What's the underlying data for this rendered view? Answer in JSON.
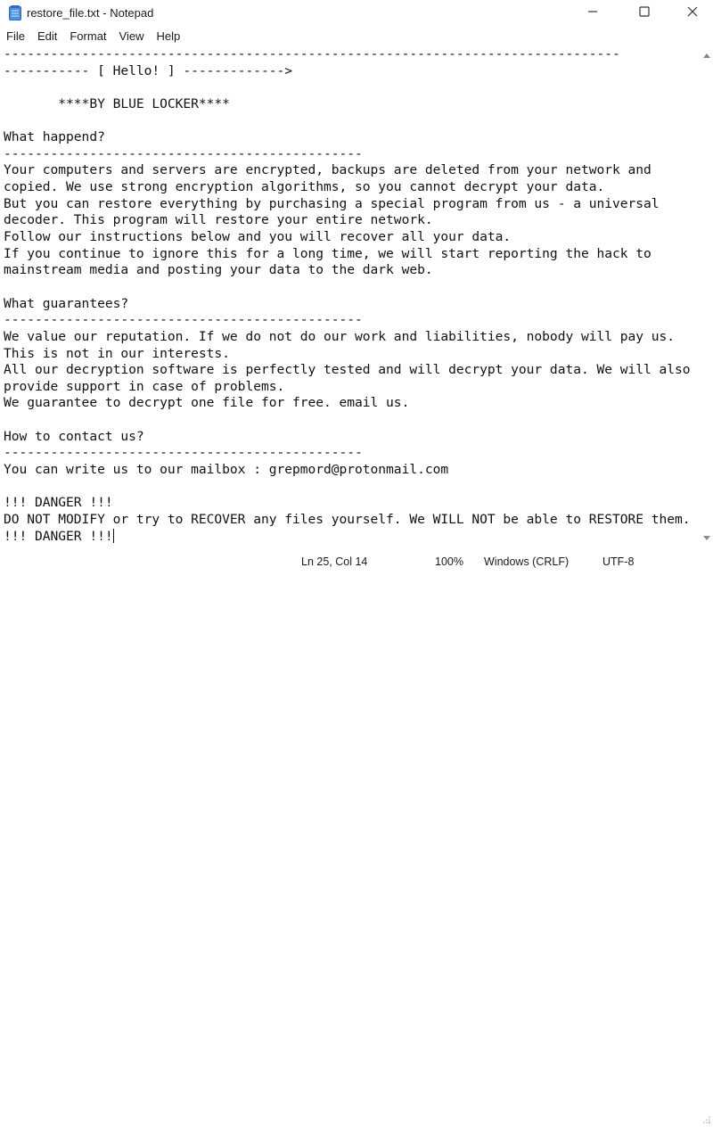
{
  "window": {
    "title": "restore_file.txt - Notepad",
    "app_icon": "notepad-icon",
    "controls": {
      "minimize": "minimize-icon",
      "maximize": "maximize-icon",
      "close": "close-icon"
    }
  },
  "menu": {
    "items": [
      {
        "label": "File"
      },
      {
        "label": "Edit"
      },
      {
        "label": "Format"
      },
      {
        "label": "View"
      },
      {
        "label": "Help"
      }
    ]
  },
  "editor": {
    "lines": [
      "-------------------------------------------------------------------------------",
      "----------- [ Hello! ] ------------->",
      "",
      "       ****BY BLUE LOCKER****",
      "",
      "What happend?",
      "----------------------------------------------",
      "Your computers and servers are encrypted, backups are deleted from your network and",
      "copied. We use strong encryption algorithms, so you cannot decrypt your data.",
      "But you can restore everything by purchasing a special program from us - a universal",
      "decoder. This program will restore your entire network.",
      "Follow our instructions below and you will recover all your data.",
      "If you continue to ignore this for a long time, we will start reporting the hack to",
      "mainstream media and posting your data to the dark web.",
      "",
      "What guarantees?",
      "----------------------------------------------",
      "We value our reputation. If we do not do our work and liabilities, nobody will pay us.",
      "This is not in our interests.",
      "All our decryption software is perfectly tested and will decrypt your data. We will also",
      "provide support in case of problems.",
      "We guarantee to decrypt one file for free. email us.",
      "",
      "How to contact us?",
      "----------------------------------------------",
      "You can write us to our mailbox : grepmord@protonmail.com",
      "",
      "!!! DANGER !!!",
      "DO NOT MODIFY or try to RECOVER any files yourself. We WILL NOT be able to RESTORE them.",
      "!!! DANGER !!!"
    ]
  },
  "statusbar": {
    "position": "Ln 25, Col 14",
    "zoom": "100%",
    "line_ending": "Windows (CRLF)",
    "encoding": "UTF-8"
  },
  "colors": {
    "icon_blue": "#3a7bd5",
    "text": "#111111",
    "background": "#ffffff"
  }
}
